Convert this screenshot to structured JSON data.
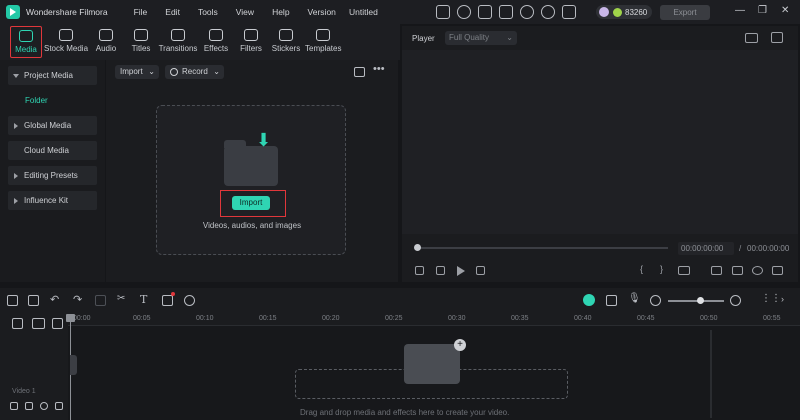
{
  "app": {
    "name": "Wondershare Filmora",
    "document_title": "Untitled"
  },
  "menu": [
    "File",
    "Edit",
    "Tools",
    "View",
    "Help",
    "Version"
  ],
  "header": {
    "credits": "83260",
    "export_label": "Export"
  },
  "toolbar": {
    "tabs": [
      {
        "label": "Media",
        "icon": "media-icon",
        "active": true
      },
      {
        "label": "Stock Media",
        "icon": "stock-media-icon"
      },
      {
        "label": "Audio",
        "icon": "audio-icon"
      },
      {
        "label": "Titles",
        "icon": "titles-icon"
      },
      {
        "label": "Transitions",
        "icon": "transitions-icon"
      },
      {
        "label": "Effects",
        "icon": "effects-icon"
      },
      {
        "label": "Filters",
        "icon": "filters-icon"
      },
      {
        "label": "Stickers",
        "icon": "stickers-icon"
      },
      {
        "label": "Templates",
        "icon": "templates-icon"
      }
    ]
  },
  "sidebar": {
    "project_media": "Project Media",
    "folder": "Folder",
    "global_media": "Global Media",
    "cloud_media": "Cloud Media",
    "editing_presets": "Editing Presets",
    "influence_kit": "Influence Kit"
  },
  "media": {
    "import_dropdown": "Import",
    "record_dropdown": "Record",
    "import_button": "Import",
    "drop_text": "Videos, audios, and images"
  },
  "player": {
    "label": "Player",
    "quality": "Full Quality",
    "current_time": "00:00:00:00",
    "separator": "/",
    "total_time": "00:00:00:00"
  },
  "timeline": {
    "ruler": [
      "00:00",
      "00:05",
      "00:10",
      "00:15",
      "00:20",
      "00:25",
      "00:30",
      "00:35",
      "00:40",
      "00:45",
      "00:50",
      "00:55"
    ],
    "track_label": "Video 1",
    "hint": "Drag and drop media and effects here to create your video."
  }
}
